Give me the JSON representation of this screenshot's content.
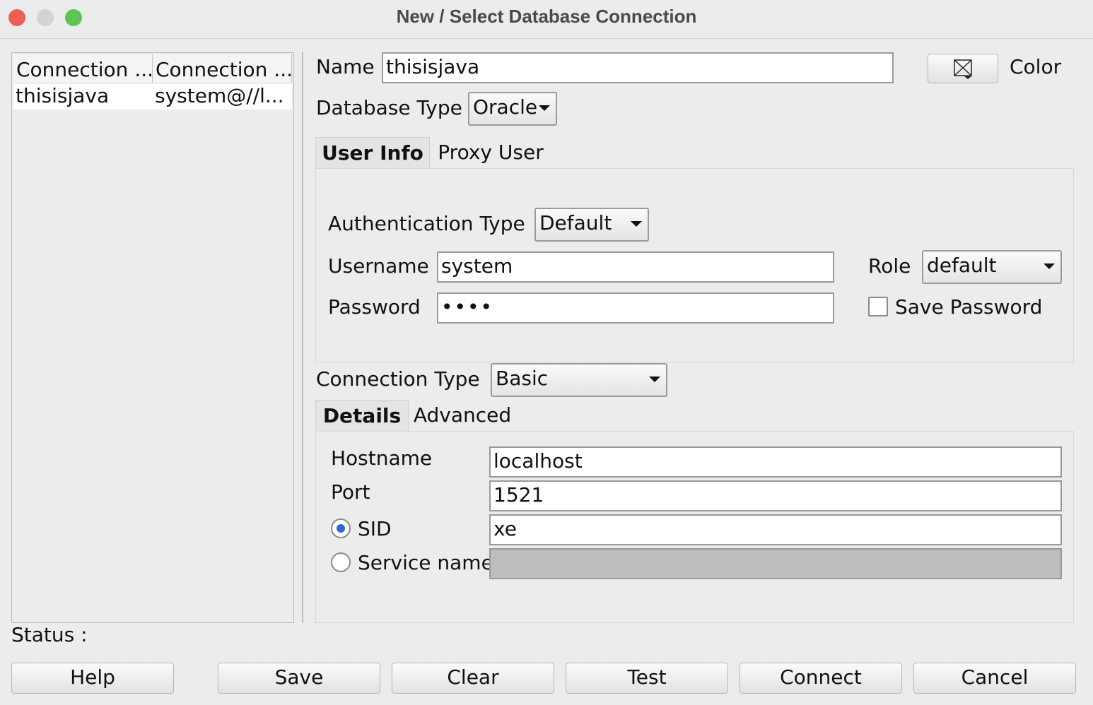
{
  "window": {
    "title": "New / Select Database Connection"
  },
  "connections_table": {
    "columns": [
      "Connection ...",
      "Connection ..."
    ],
    "rows": [
      [
        "thisisjava",
        "system@//l..."
      ]
    ]
  },
  "form": {
    "name_label": "Name",
    "name_value": "thisisjava",
    "color_label": "Color",
    "database_type_label": "Database Type",
    "database_type_value": "Oracle",
    "tabs": [
      "User Info",
      "Proxy User"
    ],
    "authentication_type_label": "Authentication Type",
    "authentication_type_value": "Default",
    "username_label": "Username",
    "username_value": "system",
    "password_label": "Password",
    "password_value": "••••",
    "role_label": "Role",
    "role_value": "default",
    "save_password_label": "Save Password",
    "save_password_checked": false,
    "connection_type_label": "Connection Type",
    "connection_type_value": "Basic",
    "detail_tabs": [
      "Details",
      "Advanced"
    ],
    "hostname_label": "Hostname",
    "hostname_value": "localhost",
    "port_label": "Port",
    "port_value": "1521",
    "sid_label": "SID",
    "sid_value": "xe",
    "sid_selected": true,
    "service_name_label": "Service name",
    "service_name_value": ""
  },
  "status": {
    "label": "Status :"
  },
  "buttons": {
    "help": "Help",
    "save": "Save",
    "clear": "Clear",
    "test": "Test",
    "connect": "Connect",
    "cancel": "Cancel"
  }
}
